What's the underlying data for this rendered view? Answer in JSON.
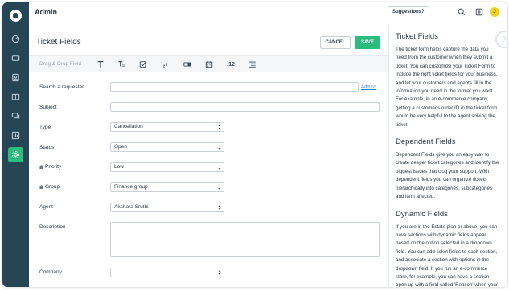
{
  "app": {
    "title": "Admin"
  },
  "topbar": {
    "suggestions_label": "Suggestions?",
    "avatar_initial": "J"
  },
  "page": {
    "title": "Ticket Fields",
    "cancel_label": "CANCEL",
    "save_label": "SAVE"
  },
  "toolbar": {
    "drag_drop_label": "Drag & Drop Field",
    "number_label": ".12"
  },
  "form": {
    "requester_label": "Search a requester",
    "add_cc_label": "Add cc",
    "subject_label": "Subject",
    "type_label": "Type",
    "type_value": "Cancellation",
    "status_label": "Status",
    "status_value": "Open",
    "priority_label": "Priority",
    "priority_value": "Low",
    "group_label": "Group",
    "group_value": "Finance group",
    "agent_label": "Agent",
    "agent_value": "Akshara Sruthi",
    "description_label": "Description",
    "company_label": "Company",
    "company_value": ""
  },
  "help": {
    "h1": "Ticket Fields",
    "p1": "The ticket form helps capture the data you need from the customer when they submit a ticket. You can customize your Ticket Form to include the right ticket fields for your business, and let your customers and agents fill in the information you need in the format you want. For example, in an e-commerce company, getting a customer's order ID in the ticket form would be very helpful to the agent solving the ticket.",
    "h2": "Dependent Fields",
    "p2": "Dependent Fields give you an easy way to create deeper ticket categories and identify the biggest issues that clog your support. With dependent fields you can organize tickets hierarchically into categories, subcategories and item affected.",
    "h3": "Dynamic Fields",
    "p3": "If you are in the Estate plan or above, you can have sections with dynamic fields appear based on the option selected in a dropdown field. You can add ticket fields to each section, and associate a section with options in the dropdown field. If you run an e-commerce store, for example, you can have a section open up with a field called 'Reason' when your customer chooses the option",
    "fab": "?"
  },
  "colors": {
    "sidebar": "#264555",
    "accent": "#2bbd7e",
    "link": "#2c7be5"
  }
}
